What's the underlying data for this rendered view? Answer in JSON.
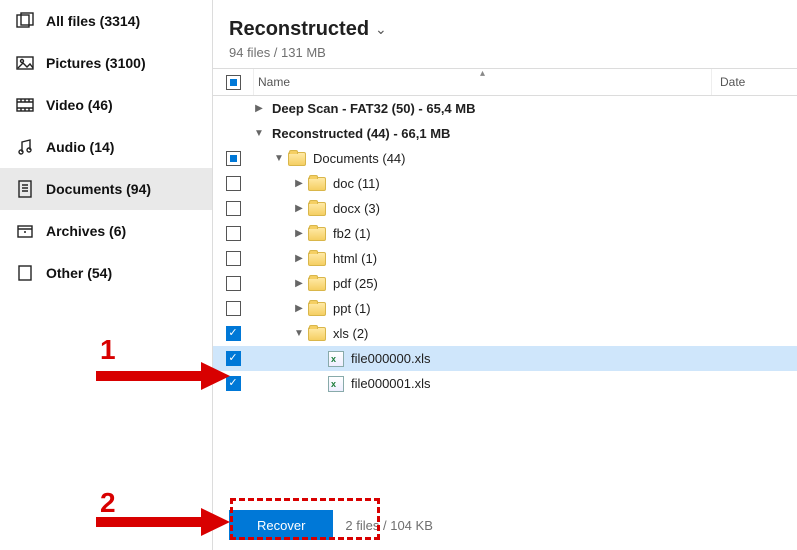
{
  "sidebar": {
    "items": [
      {
        "label": "All files (3314)",
        "icon": "allfiles-icon"
      },
      {
        "label": "Pictures (3100)",
        "icon": "pictures-icon"
      },
      {
        "label": "Video (46)",
        "icon": "video-icon"
      },
      {
        "label": "Audio (14)",
        "icon": "audio-icon"
      },
      {
        "label": "Documents (94)",
        "icon": "documents-icon"
      },
      {
        "label": "Archives (6)",
        "icon": "archives-icon"
      },
      {
        "label": "Other (54)",
        "icon": "other-icon"
      }
    ],
    "active_index": 4
  },
  "header": {
    "title": "Reconstructed",
    "subtitle": "94 files / 131 MB"
  },
  "columns": {
    "name": "Name",
    "date": "Date"
  },
  "tree": [
    {
      "indent": 0,
      "expander": "collapsed",
      "check": "none",
      "folder": false,
      "bold": true,
      "label": "Deep Scan - FAT32 (50) - 65,4 MB"
    },
    {
      "indent": 0,
      "expander": "expanded",
      "check": "none",
      "folder": false,
      "bold": true,
      "label": "Reconstructed (44) - 66,1 MB"
    },
    {
      "indent": 1,
      "expander": "expanded",
      "check": "square",
      "folder": true,
      "label": "Documents (44)"
    },
    {
      "indent": 2,
      "expander": "collapsed",
      "check": "empty",
      "folder": true,
      "label": "doc (11)"
    },
    {
      "indent": 2,
      "expander": "collapsed",
      "check": "empty",
      "folder": true,
      "label": "docx (3)"
    },
    {
      "indent": 2,
      "expander": "collapsed",
      "check": "empty",
      "folder": true,
      "label": "fb2 (1)"
    },
    {
      "indent": 2,
      "expander": "collapsed",
      "check": "empty",
      "folder": true,
      "label": "html (1)"
    },
    {
      "indent": 2,
      "expander": "collapsed",
      "check": "empty",
      "folder": true,
      "label": "pdf (25)"
    },
    {
      "indent": 2,
      "expander": "collapsed",
      "check": "empty",
      "folder": true,
      "label": "ppt (1)"
    },
    {
      "indent": 2,
      "expander": "expanded",
      "check": "checked",
      "folder": true,
      "label": "xls (2)"
    },
    {
      "indent": 3,
      "expander": "none",
      "check": "checked",
      "file": "xls",
      "label": "file000000.xls",
      "selected": true
    },
    {
      "indent": 3,
      "expander": "none",
      "check": "checked",
      "file": "xls",
      "label": "file000001.xls"
    }
  ],
  "footer": {
    "button": "Recover",
    "info": "2 files / 104 KB"
  },
  "annotations": {
    "one": "1",
    "two": "2"
  }
}
